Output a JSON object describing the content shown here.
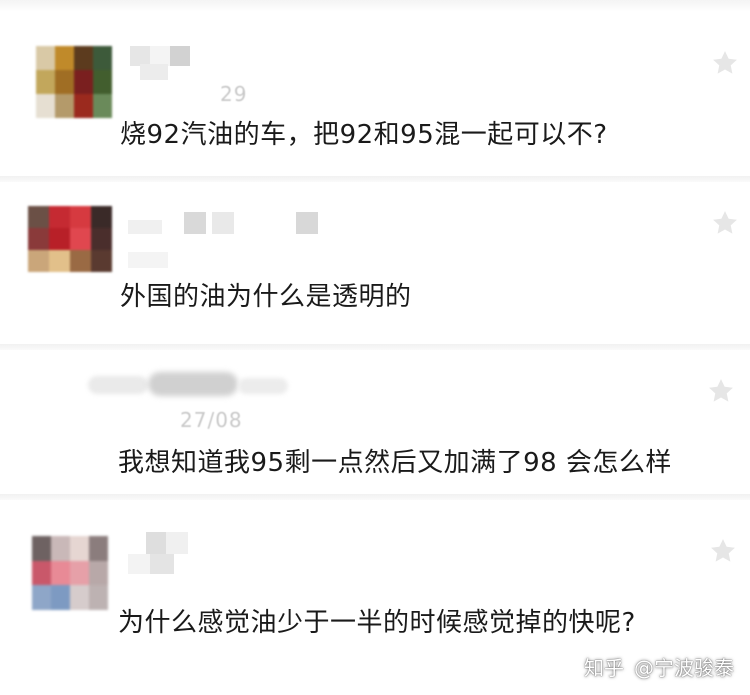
{
  "comments": [
    {
      "meta": "29",
      "text": "烧92汽油的车，把92和95混一起可以不?",
      "star_icon": "star-icon",
      "avatar_colors": [
        "#d9c9a6",
        "#c08a2a",
        "#5c3b1e",
        "#3d5a3a",
        "#c2a75c",
        "#a06e24",
        "#7a1f1f",
        "#425e2e",
        "#e6dfd2",
        "#b49a6a",
        "#9b2a1e",
        "#6a8a5a"
      ]
    },
    {
      "meta": "",
      "text": "外国的油为什么是透明的",
      "star_icon": "star-icon",
      "avatar_colors": [
        "#6b5046",
        "#c52a32",
        "#d63a40",
        "#3a2a28",
        "#8a3a3a",
        "#b82028",
        "#e0474f",
        "#4a2e2c",
        "#caa67a",
        "#e2c08a",
        "#9a6a44",
        "#5a3a30"
      ]
    },
    {
      "meta": "27/08",
      "text": "我想知道我95剩一点然后又加满了98 会怎么样",
      "star_icon": "star-icon",
      "avatar_colors": []
    },
    {
      "meta": "",
      "text": "为什么感觉油少于一半的时候感觉掉的快呢?",
      "star_icon": "star-icon",
      "avatar_colors": [
        "#6e6262",
        "#c9b8b8",
        "#e6d6d2",
        "#8b7d7d",
        "#c9586a",
        "#e88a96",
        "#e6a0a8",
        "#b8a8a8",
        "#8ea6c8",
        "#7d9ac2",
        "#d6cccc",
        "#bdb2b2"
      ]
    }
  ],
  "watermark": {
    "platform": "知乎",
    "author": "@宁波骏泰"
  },
  "colors": {
    "text": "#1a1a1a",
    "meta": "#c9c9c9",
    "star": "#e6e6e6"
  }
}
